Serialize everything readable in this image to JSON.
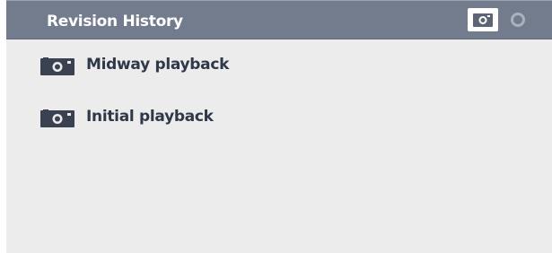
{
  "panel": {
    "title": "Revision History"
  },
  "header_actions": [
    {
      "name": "camera-icon"
    },
    {
      "name": "circle-icon"
    }
  ],
  "revisions": [
    {
      "label": "Midway playback",
      "icon": "camera-icon"
    },
    {
      "label": "Initial playback",
      "icon": "camera-icon"
    }
  ],
  "colors": {
    "header_bg": "#727c8d",
    "panel_bg": "#ececec",
    "title_text": "#ffffff",
    "item_text": "#2f3848",
    "icon_dark": "#3a4251"
  }
}
